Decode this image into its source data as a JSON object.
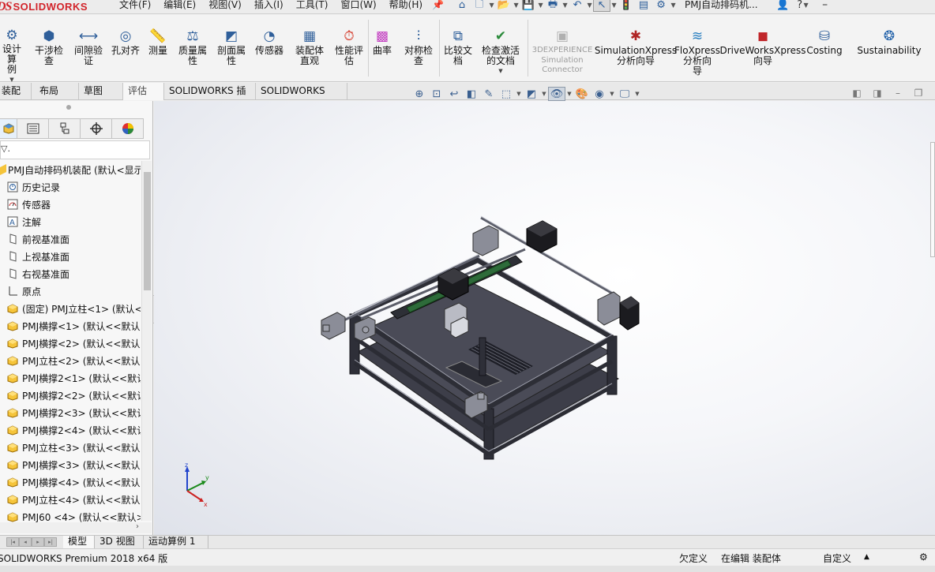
{
  "app": {
    "logo_ds": "DS",
    "logo_text": "SOLIDWORKS",
    "document_title": "PMJ自动排码机..."
  },
  "menu": [
    "文件(F)",
    "编辑(E)",
    "视图(V)",
    "插入(I)",
    "工具(T)",
    "窗口(W)",
    "帮助(H)"
  ],
  "ribbon": {
    "tools": [
      {
        "label": "设计算\n例",
        "icon": "design-study-icon",
        "dropdown": true
      },
      {
        "label": "干涉检\n查",
        "icon": "interference-icon"
      },
      {
        "label": "间隙验\n证",
        "icon": "clearance-icon"
      },
      {
        "label": "孔对齐",
        "icon": "hole-align-icon"
      },
      {
        "label": "测量",
        "icon": "measure-icon"
      },
      {
        "label": "质量属\n性",
        "icon": "mass-properties-icon"
      },
      {
        "label": "剖面属\n性",
        "icon": "section-properties-icon"
      },
      {
        "label": "传感器",
        "icon": "sensor-icon"
      },
      {
        "label": "装配体\n直观",
        "icon": "assembly-visualization-icon"
      },
      {
        "label": "性能评\n估",
        "icon": "performance-icon"
      },
      {
        "label": "曲率",
        "icon": "curvature-icon"
      },
      {
        "label": "对称检\n查",
        "icon": "symmetry-icon"
      },
      {
        "label": "比较文\n档",
        "icon": "compare-icon"
      },
      {
        "label": "检查激活\n的文档",
        "icon": "check-active-icon",
        "dropdown": true
      },
      {
        "label": "3DEXPERIENCE\nSimulation\nConnector",
        "icon": "3dx-connector-icon",
        "disabled": true
      },
      {
        "label": "SimulationXpress\n分析向导",
        "icon": "simulationxpress-icon"
      },
      {
        "label": "FloXpress\n分析向\n导",
        "icon": "floxpress-icon"
      },
      {
        "label": "DriveWorksXpress\n向导",
        "icon": "driveworks-icon"
      },
      {
        "label": "Costing",
        "icon": "costing-icon"
      },
      {
        "label": "Sustainability",
        "icon": "sustainability-icon"
      }
    ]
  },
  "tabs": [
    "装配体",
    "布局",
    "草图",
    "评估",
    "SOLIDWORKS 插件",
    "SOLIDWORKS MBD"
  ],
  "active_tab": "评估",
  "feature_tree": {
    "root": "PMJ自动排码机装配 (默认<显示",
    "items": [
      {
        "label": "历史记录",
        "icon": "history-icon"
      },
      {
        "label": "传感器",
        "icon": "sensor-icon"
      },
      {
        "label": "注解",
        "icon": "annotation-icon"
      },
      {
        "label": "前视基准面",
        "icon": "plane-icon"
      },
      {
        "label": "上视基准面",
        "icon": "plane-icon"
      },
      {
        "label": "右视基准面",
        "icon": "plane-icon"
      },
      {
        "label": "原点",
        "icon": "origin-icon"
      },
      {
        "label": "(固定) PMJ立柱<1> (默认<",
        "icon": "part-icon"
      },
      {
        "label": "PMJ横撑<1> (默认<<默认",
        "icon": "part-icon"
      },
      {
        "label": "PMJ横撑<2> (默认<<默认",
        "icon": "part-icon"
      },
      {
        "label": "PMJ立柱<2> (默认<<默认",
        "icon": "part-icon"
      },
      {
        "label": "PMJ横撑2<1> (默认<<默认",
        "icon": "part-icon"
      },
      {
        "label": "PMJ横撑2<2> (默认<<默认",
        "icon": "part-icon"
      },
      {
        "label": "PMJ横撑2<3> (默认<<默认",
        "icon": "part-icon"
      },
      {
        "label": "PMJ横撑2<4> (默认<<默认",
        "icon": "part-icon"
      },
      {
        "label": "PMJ立柱<3> (默认<<默认",
        "icon": "part-icon"
      },
      {
        "label": "PMJ横撑<3> (默认<<默认",
        "icon": "part-icon"
      },
      {
        "label": "PMJ横撑<4> (默认<<默认",
        "icon": "part-icon"
      },
      {
        "label": "PMJ立柱<4> (默认<<默认",
        "icon": "part-icon"
      },
      {
        "label": "PMJ60 <4> (默认<<默认>",
        "icon": "part-icon"
      }
    ]
  },
  "bottom_tabs": [
    "模型",
    "3D 视图",
    "运动算例 1"
  ],
  "status": {
    "product": "SOLIDWORKS Premium 2018 x64 版",
    "underdefined": "欠定义",
    "editing": "在编辑 装配体",
    "units": "自定义"
  },
  "triad": {
    "x": "x",
    "y": "y",
    "z": "z"
  },
  "colors": {
    "brand_red": "#d2242a",
    "frame_dark": "#3e3f4a",
    "rail_green": "#2e6b3a"
  }
}
